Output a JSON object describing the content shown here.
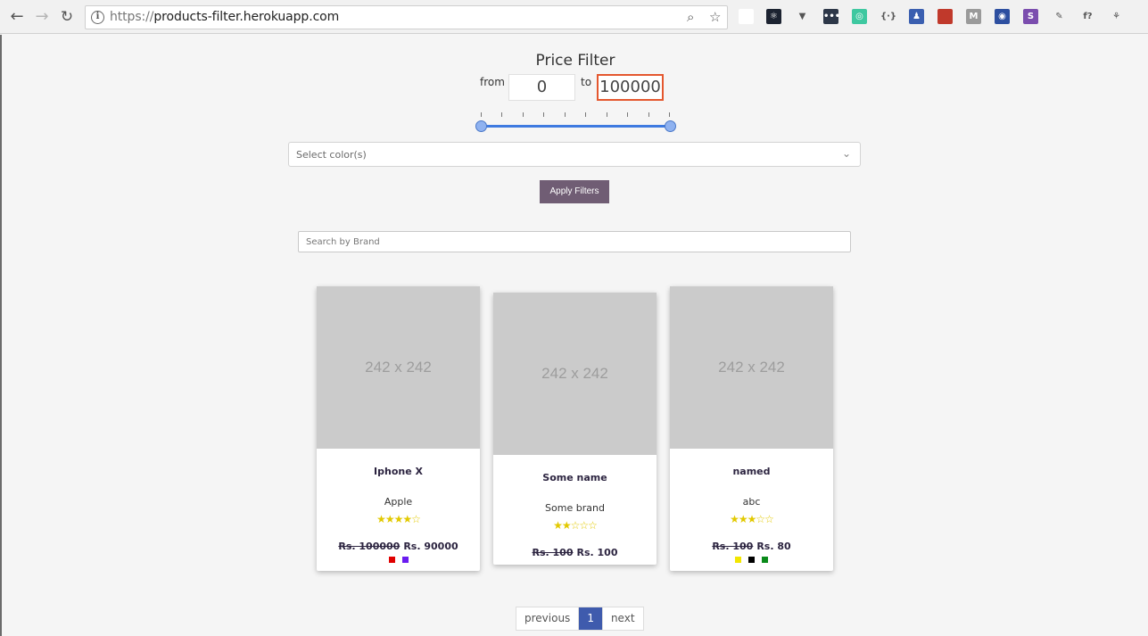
{
  "browser": {
    "url_scheme": "https://",
    "url_host": "products-filter.herokuapp.com",
    "extensions": [
      {
        "name": "ext-jz",
        "label": "",
        "color": "#ffffff"
      },
      {
        "name": "react-devtools-icon",
        "label": "⚛",
        "color": "#1c2331"
      },
      {
        "name": "vue-devtools-icon",
        "label": "▼",
        "color": "#f1f1f1"
      },
      {
        "name": "dots-icon",
        "label": "•••",
        "color": "#2d3748"
      },
      {
        "name": "circle-icon",
        "label": "◎",
        "color": "#3ec8a0"
      },
      {
        "name": "code-icon",
        "label": "{·}",
        "color": "#f1f1f1"
      },
      {
        "name": "person-icon",
        "label": "♟",
        "color": "#3b5fb0"
      },
      {
        "name": "book-icon",
        "label": "",
        "color": "#c0392b"
      },
      {
        "name": "m-icon",
        "label": "M",
        "color": "#9a9a9a"
      },
      {
        "name": "github-icon",
        "label": "◉",
        "color": "#2d4fa0"
      },
      {
        "name": "s-icon",
        "label": "S",
        "color": "#7b4dae"
      },
      {
        "name": "eyedropper-icon",
        "label": "✎",
        "color": "#f1f1f1"
      },
      {
        "name": "f-icon",
        "label": "f?",
        "color": "#f1f1f1"
      },
      {
        "name": "tree-icon",
        "label": "⚘",
        "color": "#f1f1f1"
      }
    ]
  },
  "filter": {
    "title": "Price Filter",
    "from_label": "from",
    "to_label": "to",
    "from_value": "0",
    "to_value": "100000",
    "color_placeholder": "Select color(s)",
    "apply_label": "Apply Filters",
    "search_placeholder": "Search by Brand"
  },
  "products": [
    {
      "image": "242 x 242",
      "name": "Iphone X",
      "brand": "Apple",
      "rating": 4,
      "stars": "★★★★☆",
      "old_price": "Rs. 100000",
      "price": "Rs. 90000",
      "colors": [
        "#e00000",
        "#6a1cf0"
      ]
    },
    {
      "image": "242 x 242",
      "name": "Some name",
      "brand": "Some brand",
      "rating": 2,
      "stars": "★★☆☆☆",
      "old_price": "Rs. 100",
      "price": "Rs. 100",
      "colors": []
    },
    {
      "image": "242 x 242",
      "name": "named",
      "brand": "abc",
      "rating": 3,
      "stars": "★★★☆☆",
      "old_price": "Rs. 100",
      "price": "Rs. 80",
      "colors": [
        "#f2e600",
        "#000000",
        "#0a8a1a"
      ]
    }
  ],
  "pagination": {
    "previous": "previous",
    "current": "1",
    "next": "next"
  }
}
